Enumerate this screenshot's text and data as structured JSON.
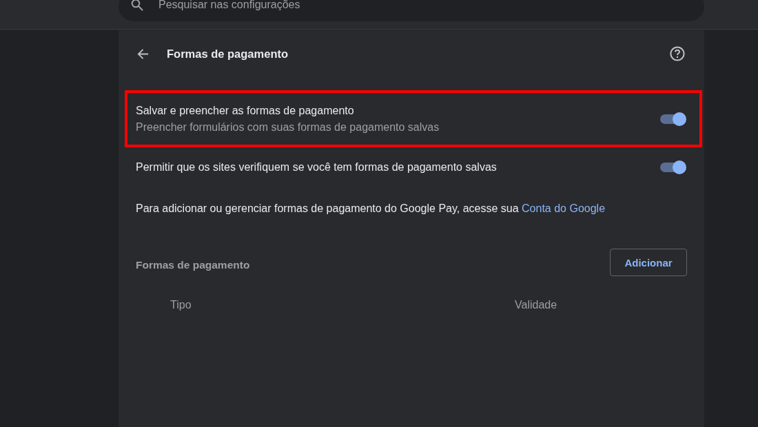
{
  "search": {
    "placeholder": "Pesquisar nas configurações"
  },
  "page": {
    "title": "Formas de pagamento"
  },
  "settings": [
    {
      "kind": "toggle",
      "label": "Salvar e preencher as formas de pagamento",
      "description": "Preencher formulários com suas formas de pagamento salvas",
      "on": true,
      "highlighted": true
    },
    {
      "kind": "toggle",
      "label": "Permitir que os sites verifiquem se você tem formas de pagamento salvas",
      "on": true,
      "highlighted": false
    },
    {
      "kind": "note",
      "text": "Para adicionar ou gerenciar formas de pagamento do Google Pay, acesse sua",
      "link": "Conta do Google",
      "highlighted": false
    }
  ],
  "payment_methods": {
    "title": "Formas de pagamento",
    "add_button": "Adicionar",
    "columns": [
      "Tipo",
      "Validade"
    ]
  }
}
